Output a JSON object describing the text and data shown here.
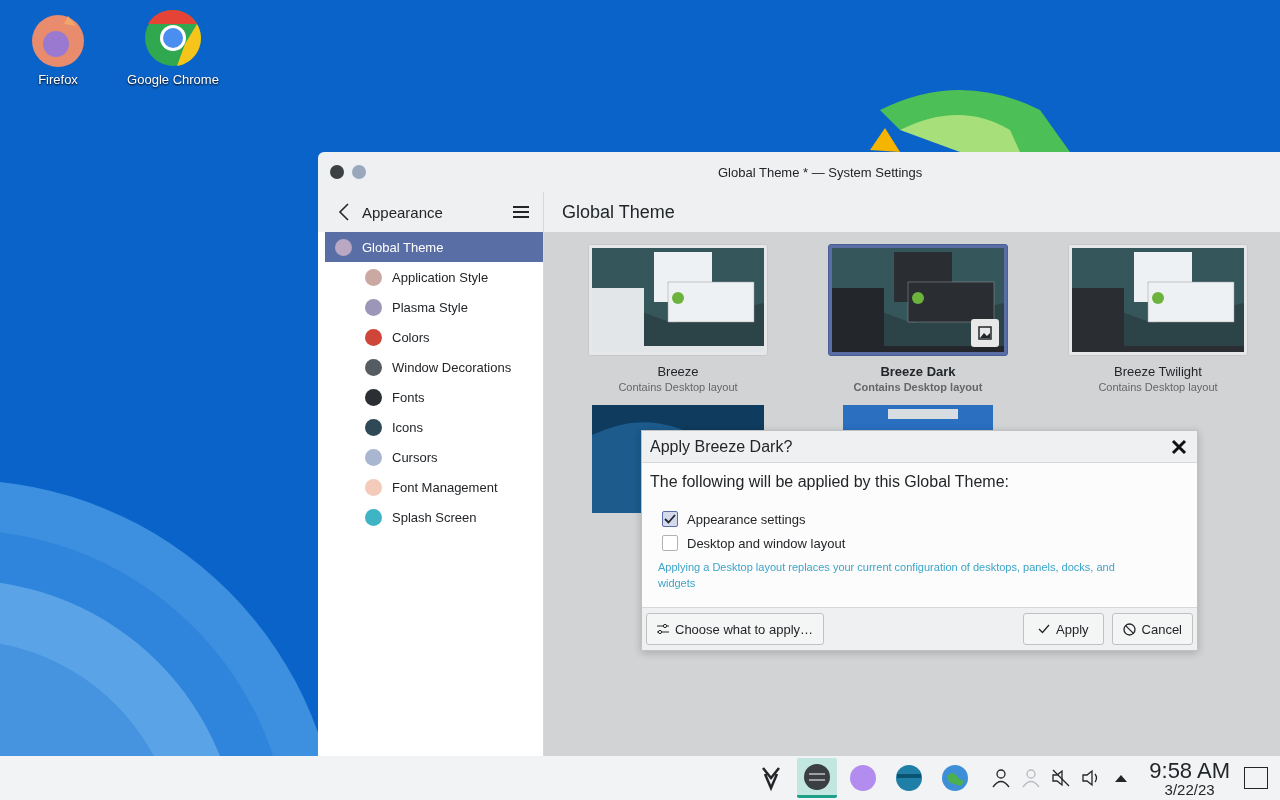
{
  "desktop_icons": [
    {
      "kind": "firefox",
      "label": "Firefox"
    },
    {
      "kind": "chrome",
      "label": "Google Chrome"
    }
  ],
  "window": {
    "title": "Global Theme * — System Settings",
    "sidebar": {
      "header": "Appearance",
      "items": [
        {
          "kind": "global",
          "label": "Global Theme",
          "selected": true,
          "children": [
            {
              "kind": "appstyle",
              "label": "Application Style",
              "selected": false
            },
            {
              "kind": "plasma",
              "label": "Plasma Style",
              "selected": false
            },
            {
              "kind": "colors",
              "label": "Colors",
              "selected": false
            },
            {
              "kind": "deco",
              "label": "Window Decorations",
              "selected": false
            },
            {
              "kind": "fonts",
              "label": "Fonts",
              "selected": false
            },
            {
              "kind": "icons",
              "label": "Icons",
              "selected": false
            },
            {
              "kind": "cursors",
              "label": "Cursors",
              "selected": false
            },
            {
              "kind": "fontmgmt",
              "label": "Font Management",
              "selected": false
            },
            {
              "kind": "splash",
              "label": "Splash Screen",
              "selected": false
            }
          ]
        }
      ]
    },
    "page_title": "Global Theme",
    "themes": [
      {
        "kind": "light",
        "name": "Breeze",
        "subtitle": "Contains Desktop layout",
        "selected": false
      },
      {
        "kind": "dark",
        "name": "Breeze Dark",
        "subtitle": "Contains Desktop layout",
        "selected": true
      },
      {
        "kind": "twilight",
        "name": "Breeze Twilight",
        "subtitle": "Contains Desktop layout",
        "selected": false
      }
    ],
    "dialog": {
      "title": "Apply Breeze Dark?",
      "heading": "The following will be applied by this Global Theme:",
      "options": [
        {
          "label": "Appearance settings",
          "checked": true
        },
        {
          "label": "Desktop and window layout",
          "checked": false
        }
      ],
      "note": "Applying a Desktop layout replaces your current configuration of desktops, panels, docks, and widgets",
      "buttons": [
        {
          "kind": "choose",
          "label": "Choose what to apply…"
        },
        {
          "kind": "apply",
          "label": "Apply"
        },
        {
          "kind": "cancel",
          "label": "Cancel"
        }
      ]
    }
  },
  "taskbar": {
    "tasks": [
      {
        "kind": "steam",
        "selected": false
      },
      {
        "kind": "settings",
        "selected": true
      },
      {
        "kind": "shop",
        "selected": false
      },
      {
        "kind": "files",
        "selected": false
      },
      {
        "kind": "browser",
        "selected": false
      }
    ],
    "tray": [
      {
        "kind": "user"
      },
      {
        "kind": "user-off"
      },
      {
        "kind": "muted"
      },
      {
        "kind": "volume"
      },
      {
        "kind": "expand"
      }
    ],
    "time": "9:58 AM",
    "date": "3/22/23"
  }
}
